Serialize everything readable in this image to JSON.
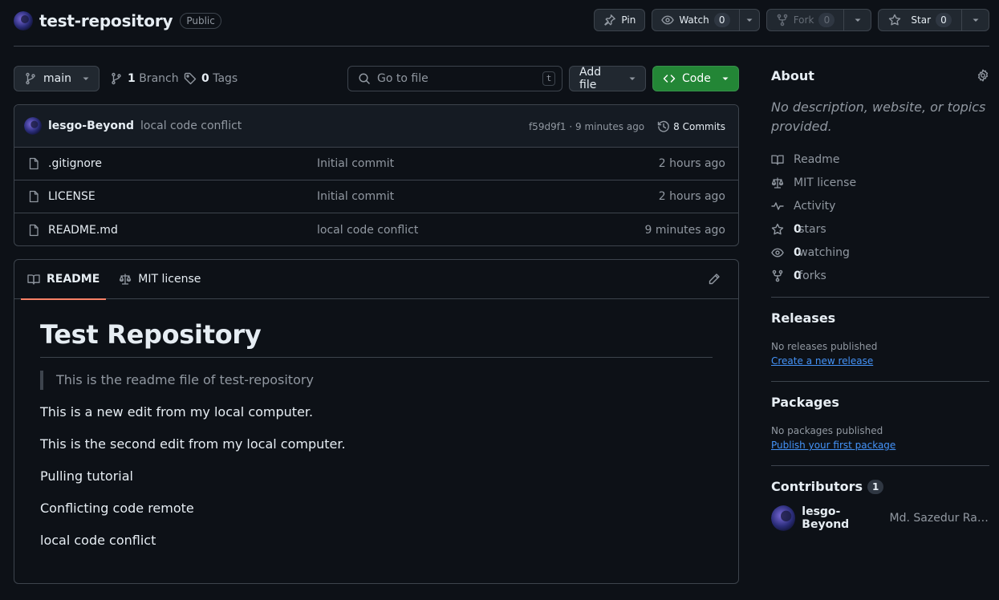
{
  "repo": {
    "name": "test-repository",
    "visibility": "Public"
  },
  "actions": {
    "pin_label": "Pin",
    "watch_label": "Watch",
    "watch_count": "0",
    "fork_label": "Fork",
    "fork_count": "0",
    "star_label": "Star",
    "star_count": "0"
  },
  "toolbar": {
    "branch": "main",
    "branch_count": "1",
    "branch_label": "Branch",
    "tag_count": "0",
    "tag_label": "Tags",
    "goto_placeholder": "Go to file",
    "goto_shortcut": "t",
    "add_file_label": "Add file",
    "code_label": "Code"
  },
  "latest_commit": {
    "author": "lesgo-Beyond",
    "message": "local code conflict",
    "hash_time": "f59d9f1 · 9 minutes ago",
    "commits_label": "8 Commits"
  },
  "files": [
    {
      "name": ".gitignore",
      "commit": "Initial commit",
      "time": "2 hours ago"
    },
    {
      "name": "LICENSE",
      "commit": "Initial commit",
      "time": "2 hours ago"
    },
    {
      "name": "README.md",
      "commit": "local code conflict",
      "time": "9 minutes ago"
    }
  ],
  "readme": {
    "tab_readme": "README",
    "tab_license": "MIT license",
    "title": "Test Repository",
    "quote": "This is the readme file of test-repository",
    "paragraphs": [
      "This is a new edit from my local computer.",
      "This is the second edit from my local computer.",
      "Pulling tutorial",
      "Conflicting code remote",
      "local code conflict"
    ]
  },
  "about": {
    "heading": "About",
    "description": "No description, website, or topics provided.",
    "readme": "Readme",
    "license": "MIT license",
    "activity": "Activity",
    "stars_count": "0",
    "stars_label": "stars",
    "watching_count": "0",
    "watching_label": "watching",
    "forks_count": "0",
    "forks_label": "forks"
  },
  "releases": {
    "heading": "Releases",
    "empty": "No releases published",
    "link": "Create a new release"
  },
  "packages": {
    "heading": "Packages",
    "empty": "No packages published",
    "link": "Publish your first package"
  },
  "contributors": {
    "heading": "Contributors",
    "count": "1",
    "items": [
      {
        "login": "lesgo-Beyond",
        "name": "Md. Sazedur Rah..."
      }
    ]
  },
  "colors": {
    "background": "#0d1117",
    "border": "#3d444d",
    "muted": "#9198a1",
    "code_button": "#238636",
    "link": "#4493f8",
    "tab_underline": "#f78166"
  }
}
